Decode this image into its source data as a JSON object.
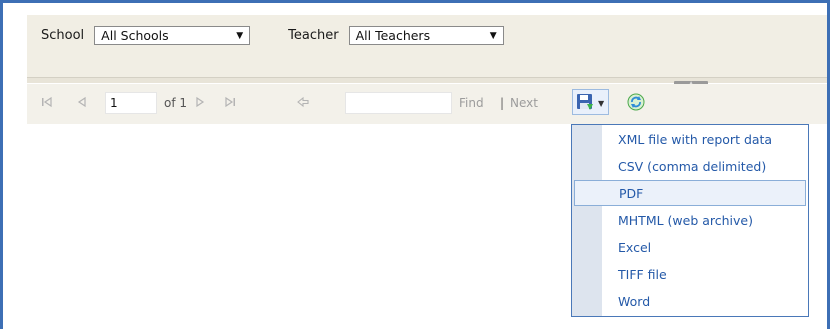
{
  "params": {
    "school_label": "School",
    "school_value": "All Schools",
    "teacher_label": "Teacher",
    "teacher_value": "All Teachers"
  },
  "toolbar": {
    "page_current": "1",
    "page_of": "of 1",
    "find_placeholder": "",
    "find_label": "Find",
    "separator": "|",
    "next_label": "Next"
  },
  "export_menu": {
    "items": [
      {
        "label": "XML file with report data"
      },
      {
        "label": "CSV (comma delimited)"
      },
      {
        "label": "PDF"
      },
      {
        "label": "MHTML (web archive)"
      },
      {
        "label": "Excel"
      },
      {
        "label": "TIFF file"
      },
      {
        "label": "Word"
      }
    ],
    "highlighted": "PDF"
  },
  "colors": {
    "frame": "#3d6fb5",
    "menu_text": "#2459a8",
    "param_bg": "#f1eee4"
  }
}
